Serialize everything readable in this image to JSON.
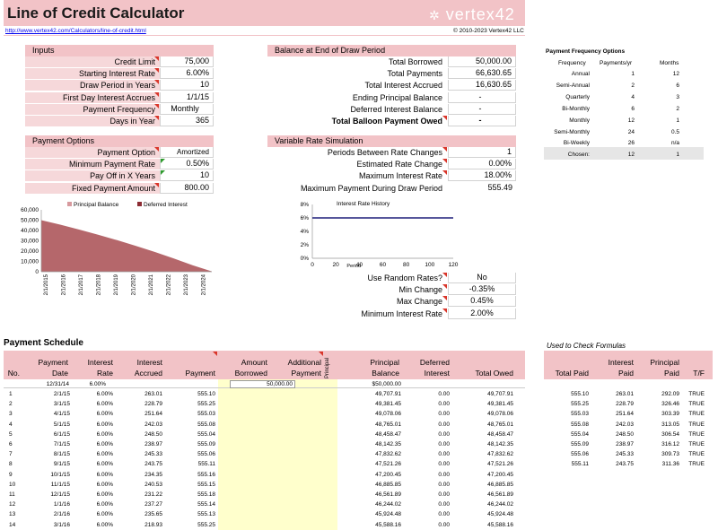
{
  "title": "Line of Credit Calculator",
  "logo": "vertex42",
  "url": "http://www.vertex42.com/Calculators/line-of-credit.html",
  "copyright": "© 2010-2023 Vertex42 LLC",
  "inputs": {
    "title": "Inputs",
    "items": [
      {
        "label": "Credit Limit",
        "value": "75,000"
      },
      {
        "label": "Starting Interest Rate",
        "value": "6.00%"
      },
      {
        "label": "Draw Period in Years",
        "value": "10"
      },
      {
        "label": "First Day Interest Accrues",
        "value": "1/1/15"
      },
      {
        "label": "Payment Frequency",
        "value": "Monthly"
      },
      {
        "label": "Days in Year",
        "value": "365"
      }
    ]
  },
  "balance": {
    "title": "Balance at End of Draw Period",
    "items": [
      {
        "label": "Total Borrowed",
        "value": "50,000.00"
      },
      {
        "label": "Total Payments",
        "value": "66,630.65"
      },
      {
        "label": "Total Interest Accrued",
        "value": "16,630.65"
      },
      {
        "label": "Ending Principal Balance",
        "value": "-"
      },
      {
        "label": "Deferred Interest Balance",
        "value": "-"
      },
      {
        "label": "Total Balloon Payment Owed",
        "value": "-"
      }
    ]
  },
  "payment_options": {
    "title": "Payment Options",
    "items": [
      {
        "label": "Payment Option",
        "value": "Amortized"
      },
      {
        "label": "Minimum Payment Rate",
        "value": "0.50%"
      },
      {
        "label": "Pay Off in X Years",
        "value": "10"
      },
      {
        "label": "Fixed Payment Amount",
        "value": "800.00"
      }
    ]
  },
  "variable": {
    "title": "Variable Rate Simulation",
    "items": [
      {
        "label": "Periods Between Rate Changes",
        "value": "1"
      },
      {
        "label": "Estimated Rate Change",
        "value": "0.00%"
      },
      {
        "label": "Maximum Interest Rate",
        "value": "18.00%"
      },
      {
        "label": "Maximum Payment During Draw Period",
        "value": "555.49"
      }
    ]
  },
  "random": {
    "items": [
      {
        "label": "Use Random Rates?",
        "value": "No"
      },
      {
        "label": "Min Change",
        "value": "-0.35%"
      },
      {
        "label": "Max Change",
        "value": "0.45%"
      },
      {
        "label": "Minimum Interest Rate",
        "value": "2.00%"
      }
    ]
  },
  "freq": {
    "title": "Payment Frequency Options",
    "headers": [
      "Frequency",
      "Payments/yr",
      "Months"
    ],
    "rows": [
      [
        "Annual",
        "1",
        "12"
      ],
      [
        "Semi-Annual",
        "2",
        "6"
      ],
      [
        "Quarterly",
        "4",
        "3"
      ],
      [
        "Bi-Monthly",
        "6",
        "2"
      ],
      [
        "Monthly",
        "12",
        "1"
      ],
      [
        "Semi-Monthly",
        "24",
        "0.5"
      ],
      [
        "Bi-Weekly",
        "26",
        "n/a"
      ],
      [
        "Chosen:",
        "12",
        "1"
      ]
    ]
  },
  "colors": {
    "header_pink": "#f2c3c7",
    "label_pink": "#f6d8da",
    "chart_area": "#b5676b",
    "rate_line": "#1f1f7a",
    "entry_yellow": "#ffffcc"
  },
  "chart_data": [
    {
      "type": "area",
      "legend": [
        "Principal Balance",
        "Deferred Interest"
      ],
      "x": [
        "2/1/2015",
        "2/1/2016",
        "2/1/2017",
        "2/1/2018",
        "2/1/2019",
        "2/1/2020",
        "2/1/2021",
        "2/1/2022",
        "2/1/2023",
        "2/1/2024"
      ],
      "yticks": [
        "60,000",
        "50,000",
        "40,000",
        "30,000",
        "20,000",
        "10,000",
        "0"
      ],
      "ylim": [
        0,
        60000
      ],
      "series": [
        {
          "name": "Principal Balance",
          "values": [
            50000,
            45600,
            40900,
            35900,
            30600,
            25000,
            19100,
            12800,
            6200,
            300
          ]
        },
        {
          "name": "Deferred Interest",
          "values": [
            0,
            0,
            0,
            0,
            0,
            0,
            0,
            0,
            0,
            0
          ]
        }
      ]
    },
    {
      "type": "line",
      "title": "Interest Rate History",
      "xlabel": "Period",
      "yticks": [
        "8%",
        "6%",
        "4%",
        "2%",
        "0%"
      ],
      "xticks": [
        "0",
        "20",
        "40",
        "60",
        "80",
        "100",
        "120"
      ],
      "ylim": [
        0,
        8
      ],
      "xlim": [
        0,
        120
      ],
      "grid": false,
      "series": [
        {
          "x": [
            0,
            120
          ],
          "y": [
            6,
            6
          ]
        }
      ]
    }
  ],
  "schedule": {
    "title": "Payment Schedule",
    "headers": [
      [
        "No.",
        ""
      ],
      [
        "Payment",
        "Date"
      ],
      [
        "Interest",
        "Rate"
      ],
      [
        "Interest",
        "Accrued"
      ],
      [
        "Payment",
        ""
      ],
      [
        "Amount",
        "Borrowed"
      ],
      [
        "Additional",
        "Payment"
      ],
      [
        "Principal",
        ""
      ],
      [
        "Principal",
        "Balance"
      ],
      [
        "Deferred",
        "Interest"
      ],
      [
        "Total Owed",
        ""
      ]
    ],
    "initial": {
      "date": "12/31/14",
      "rate": "6.00%",
      "borrowed": "50,000.00",
      "balance": "$50,000.00"
    },
    "rows": [
      [
        "1",
        "2/1/15",
        "6.00%",
        "263.01",
        "555.10",
        "49,707.91",
        "0.00",
        "49,707.91"
      ],
      [
        "2",
        "3/1/15",
        "6.00%",
        "228.79",
        "555.25",
        "49,381.45",
        "0.00",
        "49,381.45"
      ],
      [
        "3",
        "4/1/15",
        "6.00%",
        "251.64",
        "555.03",
        "49,078.06",
        "0.00",
        "49,078.06"
      ],
      [
        "4",
        "5/1/15",
        "6.00%",
        "242.03",
        "555.08",
        "48,765.01",
        "0.00",
        "48,765.01"
      ],
      [
        "5",
        "6/1/15",
        "6.00%",
        "248.50",
        "555.04",
        "48,458.47",
        "0.00",
        "48,458.47"
      ],
      [
        "6",
        "7/1/15",
        "6.00%",
        "238.97",
        "555.09",
        "48,142.35",
        "0.00",
        "48,142.35"
      ],
      [
        "7",
        "8/1/15",
        "6.00%",
        "245.33",
        "555.06",
        "47,832.62",
        "0.00",
        "47,832.62"
      ],
      [
        "8",
        "9/1/15",
        "6.00%",
        "243.75",
        "555.11",
        "47,521.26",
        "0.00",
        "47,521.26"
      ],
      [
        "9",
        "10/1/15",
        "6.00%",
        "234.35",
        "555.16",
        "47,200.45",
        "0.00",
        "47,200.45"
      ],
      [
        "10",
        "11/1/15",
        "6.00%",
        "240.53",
        "555.15",
        "46,885.85",
        "0.00",
        "46,885.85"
      ],
      [
        "11",
        "12/1/15",
        "6.00%",
        "231.22",
        "555.18",
        "46,561.89",
        "0.00",
        "46,561.89"
      ],
      [
        "12",
        "1/1/16",
        "6.00%",
        "237.27",
        "555.14",
        "46,244.02",
        "0.00",
        "46,244.02"
      ],
      [
        "13",
        "2/1/16",
        "6.00%",
        "235.65",
        "555.13",
        "45,924.48",
        "0.00",
        "45,924.48"
      ],
      [
        "14",
        "3/1/16",
        "6.00%",
        "218.93",
        "555.25",
        "45,588.16",
        "0.00",
        "45,588.16"
      ]
    ]
  },
  "check": {
    "title": "Used to Check Formulas",
    "headers": [
      [
        "Total Paid",
        ""
      ],
      [
        "Interest",
        "Paid"
      ],
      [
        "Principal",
        "Paid"
      ],
      [
        "T/F",
        ""
      ]
    ],
    "rows": [
      [
        "555.10",
        "263.01",
        "292.09",
        "TRUE"
      ],
      [
        "555.25",
        "228.79",
        "326.46",
        "TRUE"
      ],
      [
        "555.03",
        "251.64",
        "303.39",
        "TRUE"
      ],
      [
        "555.08",
        "242.03",
        "313.05",
        "TRUE"
      ],
      [
        "555.04",
        "248.50",
        "306.54",
        "TRUE"
      ],
      [
        "555.09",
        "238.97",
        "316.12",
        "TRUE"
      ],
      [
        "555.06",
        "245.33",
        "309.73",
        "TRUE"
      ],
      [
        "555.11",
        "243.75",
        "311.36",
        "TRUE"
      ]
    ]
  }
}
